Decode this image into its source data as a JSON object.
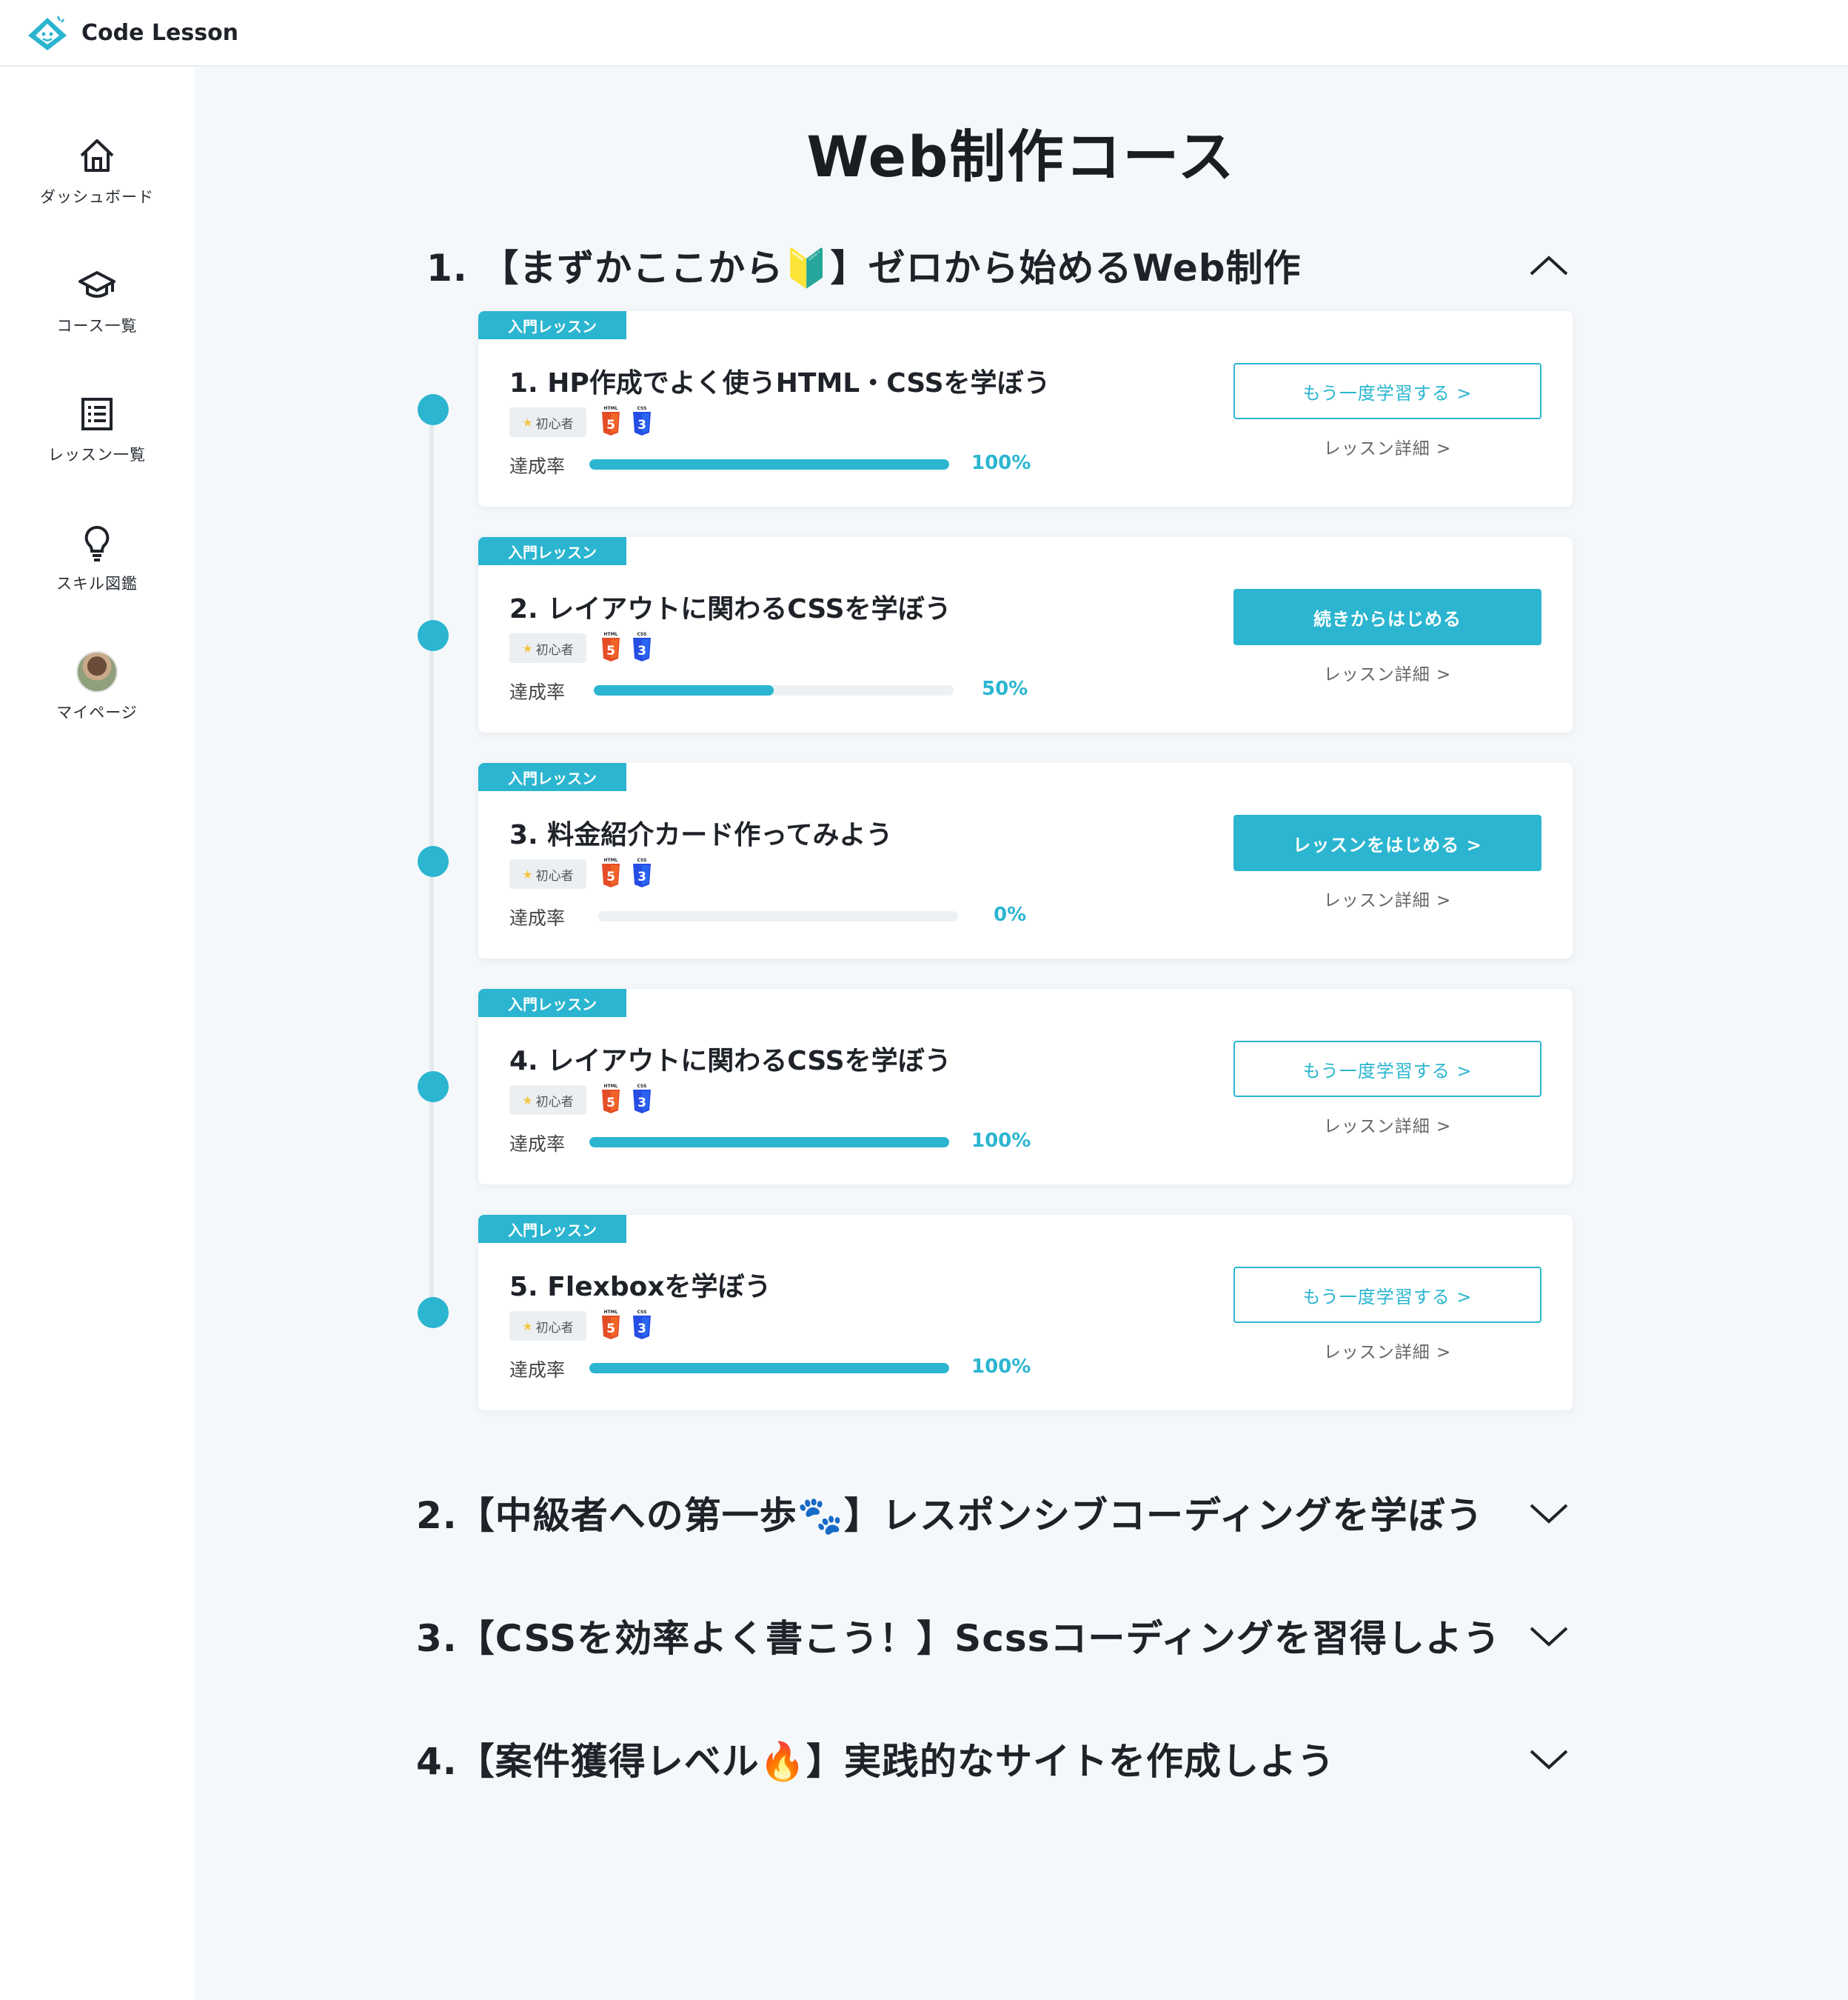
{
  "app": {
    "name": "Code Lesson"
  },
  "sidebar": {
    "items": [
      {
        "label": "ダッシュボード",
        "icon": "home-icon"
      },
      {
        "label": "コース一覧",
        "icon": "graduation-cap-icon"
      },
      {
        "label": "レッスン一覧",
        "icon": "list-icon"
      },
      {
        "label": "スキル図鑑",
        "icon": "lightbulb-icon"
      },
      {
        "label": "マイページ",
        "icon": "avatar"
      }
    ]
  },
  "page": {
    "title": "Web制作コース"
  },
  "sections": [
    {
      "title": "1. 【まずかここから🔰】ゼロから始めるWeb制作",
      "expanded": true
    },
    {
      "title": "2.【中級者への第一歩🐾】レスポンシブコーディングを学ぼう",
      "expanded": false
    },
    {
      "title": "3.【CSSを効率よく書こう！】Scssコーディングを習得しよう",
      "expanded": false
    },
    {
      "title": "4.【案件獲得レベル🔥】実践的なサイトを作成しよう",
      "expanded": false
    }
  ],
  "lessons": [
    {
      "tag": "入門レッスン",
      "title": "1. HP作成でよく使うHTML・CSSを学ぼう",
      "level": "初心者",
      "rate_label": "達成率",
      "progress": 100,
      "progress_text": "100%",
      "button": "もう一度学習する >",
      "button_style": "outline",
      "detail": "レッスン詳細 >"
    },
    {
      "tag": "入門レッスン",
      "title": "2. レイアウトに関わるCSSを学ぼう",
      "level": "初心者",
      "rate_label": "達成率",
      "progress": 50,
      "progress_text": "50%",
      "button": "続きからはじめる",
      "button_style": "solid",
      "detail": "レッスン詳細 >"
    },
    {
      "tag": "入門レッスン",
      "title": "3. 料金紹介カード作ってみよう",
      "level": "初心者",
      "rate_label": "達成率",
      "progress": 0,
      "progress_text": "0%",
      "button": "レッスンをはじめる >",
      "button_style": "solid",
      "detail": "レッスン詳細 >"
    },
    {
      "tag": "入門レッスン",
      "title": "4. レイアウトに関わるCSSを学ぼう",
      "level": "初心者",
      "rate_label": "達成率",
      "progress": 100,
      "progress_text": "100%",
      "button": "もう一度学習する >",
      "button_style": "outline",
      "detail": "レッスン詳細 >"
    },
    {
      "tag": "入門レッスン",
      "title": "5. Flexboxを学ぼう",
      "level": "初心者",
      "rate_label": "達成率",
      "progress": 100,
      "progress_text": "100%",
      "button": "もう一度学習する >",
      "button_style": "outline",
      "detail": "レッスン詳細 >"
    }
  ],
  "colors": {
    "accent": "#2bb5d0",
    "html5": "#e44d26",
    "css3": "#264de4"
  }
}
